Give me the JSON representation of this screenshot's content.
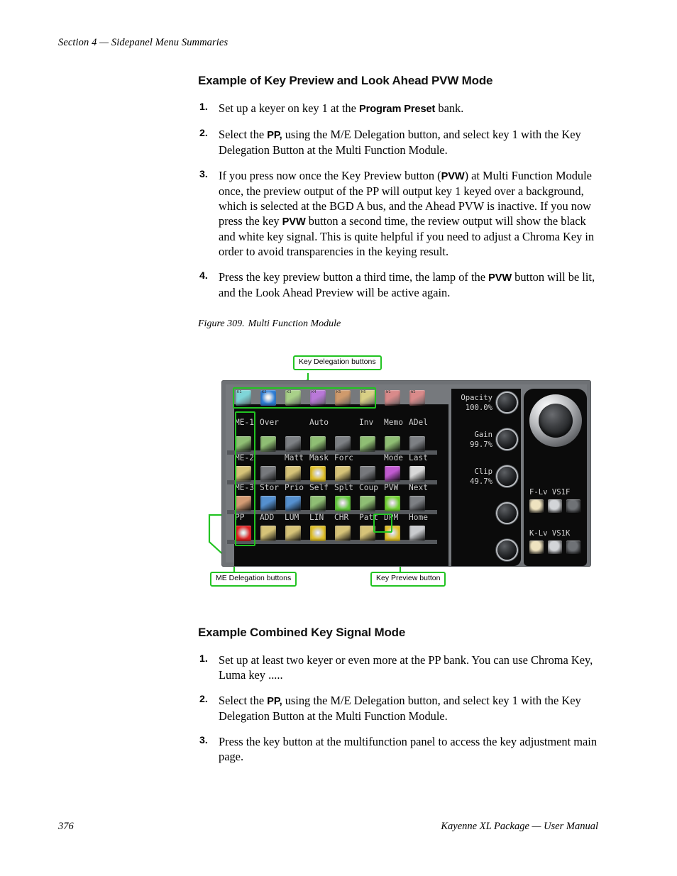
{
  "running_head": "Section 4 — Sidepanel Menu Summaries",
  "sections": [
    {
      "heading": "Example of Key Preview and Look Ahead PVW Mode",
      "steps": [
        {
          "num": "1.",
          "html": "Set up a keyer on key 1 at the <b>Program Preset</b> bank."
        },
        {
          "num": "2.",
          "html": "Select the <b>PP,</b> using the M/E Delegation button, and select key 1 with the Key Delegation Button at the Multi Function Module."
        },
        {
          "num": "3.",
          "html": "If you press now once the Key Preview button (<b>PVW</b>) at Multi Function Module once, the preview output of the PP will output key 1 keyed over a background, which is selected at the BGD A bus, and the Ahead PVW is inactive. If you now press the key <b>PVW</b> button a second time, the review output will show the black and white key signal. This is quite helpful if you need to adjust a Chroma Key in order to avoid transparencies in the keying result."
        },
        {
          "num": "4.",
          "html": "Press the key preview button a third time, the lamp of the <b>PVW</b> button will be lit, and the Look Ahead Preview will be active again."
        }
      ]
    }
  ],
  "figure": {
    "caption_number": "Figure 309.",
    "caption_text": "Multi Function Module",
    "callouts": [
      {
        "id": "key-delegation",
        "label": "Key Delegation buttons"
      },
      {
        "id": "me-delegation",
        "label": "ME Delegation buttons"
      },
      {
        "id": "key-preview",
        "label": "Key Preview button"
      }
    ],
    "panel": {
      "key_tags": [
        "K1",
        "K2",
        "K3",
        "K4",
        "K5",
        "K6",
        "W1",
        "W2"
      ],
      "rows": [
        {
          "labels": [
            "ME-1",
            "Over",
            "",
            "Auto",
            "",
            "Inv",
            "Memo",
            "ADel"
          ],
          "colors": [
            "#7fd5d8",
            "#2f7fd8",
            "#a9d189",
            "#b978d8",
            "#cf9a6c",
            "#d8cf85",
            "#d98a8a",
            "#d98a8a"
          ],
          "lit": [
            false,
            true,
            false,
            false,
            false,
            false,
            false,
            false
          ]
        },
        {
          "labels": [
            "ME-2",
            "",
            "Matt",
            "Mask",
            "Forc",
            "",
            "Mode",
            "Last"
          ],
          "colors": [
            "#8fbe74",
            "#8fbe74",
            "#7d8084",
            "#8fbe74",
            "#7d8084",
            "#8fbe74",
            "#8fbe74",
            "#7d8084"
          ],
          "lit": [
            false,
            false,
            false,
            false,
            false,
            false,
            false,
            false
          ]
        },
        {
          "labels": [
            "ME-3",
            "Stor",
            "Prio",
            "Self",
            "Splt",
            "Coup",
            "PVW",
            "Next"
          ],
          "colors": [
            "#d6c378",
            "#77797d",
            "#d6c378",
            "#e0c02a",
            "#d6c378",
            "#77797d",
            "#c05ad0",
            "#d8d8d8"
          ],
          "lit": [
            false,
            false,
            false,
            true,
            false,
            false,
            false,
            false
          ]
        },
        {
          "labels": [
            "PP",
            "ADD",
            "LUM",
            "LIN",
            "CHR",
            "Patt",
            "DPM",
            "Home"
          ],
          "colors": [
            "#d49b74",
            "#5590cf",
            "#5590cf",
            "#8fbe74",
            "#62c93a",
            "#8fbe74",
            "#6fd02f",
            "#7d8084"
          ],
          "lit": [
            false,
            false,
            false,
            false,
            true,
            false,
            true,
            false
          ]
        },
        {
          "labels": [
            "",
            "",
            "",
            "",
            "",
            "",
            "",
            ""
          ],
          "colors": [
            "#e02020",
            "#d6c378",
            "#d6c378",
            "#e0c02a",
            "#d6c378",
            "#d6c378",
            "#e0c02a",
            "#c9cbce"
          ],
          "lit": [
            true,
            false,
            false,
            true,
            false,
            false,
            true,
            false
          ]
        }
      ],
      "knobs": [
        {
          "name": "Opacity",
          "value": "100.0%"
        },
        {
          "name": "Gain",
          "value": "99.7%"
        },
        {
          "name": "Clip",
          "value": "49.7%"
        },
        {
          "name": "",
          "value": ""
        },
        {
          "name": "",
          "value": ""
        }
      ],
      "joystick_groups": [
        {
          "labels": "F-Lv VS1F",
          "buttons": [
            "#efe3c0",
            "#d3d5d8",
            "#6f7276"
          ]
        },
        {
          "labels": "K-Lv VS1K",
          "buttons": [
            "#efe3c0",
            "#d3d5d8",
            "#6f7276"
          ]
        }
      ]
    },
    "accent_color": "#22c322"
  },
  "section2": {
    "heading": "Example Combined Key Signal Mode",
    "steps": [
      {
        "num": "1.",
        "html": "Set up at least two keyer or even more at the PP bank. You can use Chroma Key, Luma key ....."
      },
      {
        "num": "2.",
        "html": "Select the <b>PP,</b> using the M/E Delegation button, and select key 1 with the Key Delegation Button at the Multi Function Module."
      },
      {
        "num": "3.",
        "html": "Press the key button at the multifunction panel to access the key adjustment main page."
      }
    ]
  },
  "footer": {
    "page_number": "376",
    "title": "Kayenne XL Package  —  User Manual"
  }
}
